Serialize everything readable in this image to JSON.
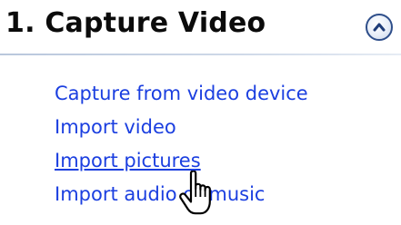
{
  "section": {
    "title": "1. Capture Video",
    "collapse_icon": "chevron-up-icon"
  },
  "tasks": [
    {
      "label": "Capture from video device"
    },
    {
      "label": "Import video"
    },
    {
      "label": "Import pictures",
      "hovered": true
    },
    {
      "label": "Import audio or music"
    }
  ],
  "cursor": {
    "icon": "hand-pointer-icon"
  },
  "colors": {
    "link": "#1b3fe0",
    "title": "#0b0b0b",
    "rule": "#b9c7dc",
    "button_border": "#2e4e8a"
  }
}
